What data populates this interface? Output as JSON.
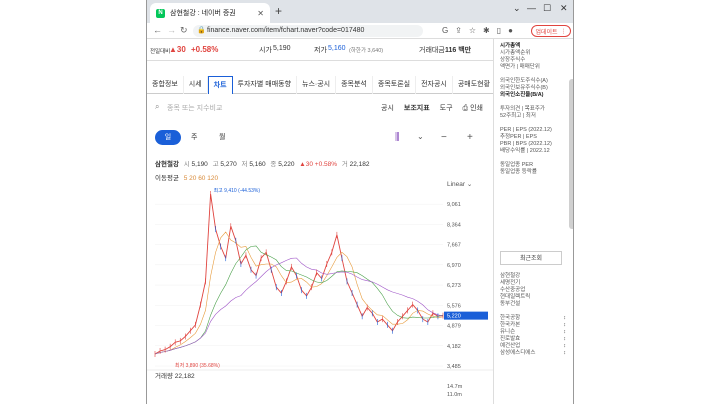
{
  "browser": {
    "tab_title": "삼현철강 : 네이버 증권",
    "url": "finance.naver.com/item/fchart.naver?code=017480",
    "update_label": "업데이트"
  },
  "quote": {
    "foreign_label": "전일대비",
    "change": "▲30",
    "change_pct": "+0.58%",
    "high_label": "시가",
    "open_value": "5,190",
    "low_label": "저가",
    "low_value": "5,160",
    "low_limit": "(하한가 3,640)",
    "volume_label": "거래대금",
    "volume_value": "116 백만"
  },
  "gnb": [
    "종합정보",
    "시세",
    "차트",
    "투자자별 매매동향",
    "뉴스·공시",
    "종목분석",
    "종목토론실",
    "전자공시",
    "공매도현황"
  ],
  "toolbar": {
    "compare_placeholder": "종목 또는 지수비교",
    "disclosure": "공시",
    "indicator": "보조지표",
    "tool": "도구",
    "print": "인쇄"
  },
  "periods": {
    "day": "일",
    "week": "주",
    "month": "월"
  },
  "info": {
    "name": "삼현철강",
    "open_l": "시",
    "open": "5,190",
    "high_l": "고",
    "high": "5,270",
    "low_l": "저",
    "low": "5,160",
    "close_l": "종",
    "close": "5,220",
    "chg": "▲30",
    "chg_pct": "+0.58%",
    "vol_l": "거",
    "vol": "22,182"
  },
  "ma": {
    "label": "이동평균",
    "values": "5 20 60 120"
  },
  "scale_label": "Linear",
  "volume_label": "거래량 22,182",
  "chart_data": {
    "type": "line",
    "y_ticks": [
      9061,
      8364,
      7667,
      6970,
      6273,
      5576,
      4879,
      4182,
      3485
    ],
    "current_price": 5220,
    "max_label": "최고 9,410 (-44.53%)",
    "min_label": "최저 3,890 (35.68%)",
    "vol_ticks": [
      "14.7m",
      "11.0m"
    ],
    "series": [
      {
        "values": [
          3900,
          4000,
          4050,
          4150,
          4300,
          4350,
          4500,
          4700,
          4900,
          5600,
          6400,
          9410,
          8200,
          7600,
          7200,
          8300,
          7800,
          7000,
          7300,
          6800,
          6600,
          7200,
          7400,
          6800,
          6200,
          6000,
          6400,
          6900,
          6600,
          6100,
          5900,
          6200,
          6700,
          6500,
          7000,
          7400,
          8000,
          7200,
          6400,
          6000,
          5600,
          5200,
          5500,
          5300,
          5000,
          5100,
          4900,
          4700,
          5000,
          5200,
          5400,
          5600,
          5400,
          5100,
          5000,
          5300,
          5200,
          5220
        ]
      }
    ]
  },
  "sidebar": {
    "items": [
      "시가총액",
      "시가총액순위",
      "상장주식수",
      "액면가 | 매매단위",
      "",
      "외국인한도주식수(A)",
      "외국인보유주식수(B)",
      "외국인소진율(B/A)",
      "",
      "투자의견 | 목표주가",
      "52주최고 | 최저",
      "",
      "PER | EPS (2022.12)",
      "추정PER | EPS",
      "PBR | BPS (2022.12)",
      "배당수익률 | 2022.12",
      "",
      "동일업종 PER",
      "동일업종 등락률"
    ],
    "recent_label": "최근조회",
    "recent": [
      {
        "name": "삼현철강",
        "mark": ""
      },
      {
        "name": "세명전기",
        "mark": ""
      },
      {
        "name": "수산중공업",
        "mark": ""
      },
      {
        "name": "현대일렉트릭",
        "mark": ""
      },
      {
        "name": "동부건설",
        "mark": ""
      },
      {
        "name": "",
        "mark": ""
      },
      {
        "name": "한국공항",
        "mark": "↕"
      },
      {
        "name": "한국카본",
        "mark": "↕"
      },
      {
        "name": "유니슨",
        "mark": "↕"
      },
      {
        "name": "진로발효",
        "mark": "↕"
      },
      {
        "name": "예건산업",
        "mark": "↕"
      },
      {
        "name": "삼성에스디에스",
        "mark": "↕"
      }
    ]
  }
}
